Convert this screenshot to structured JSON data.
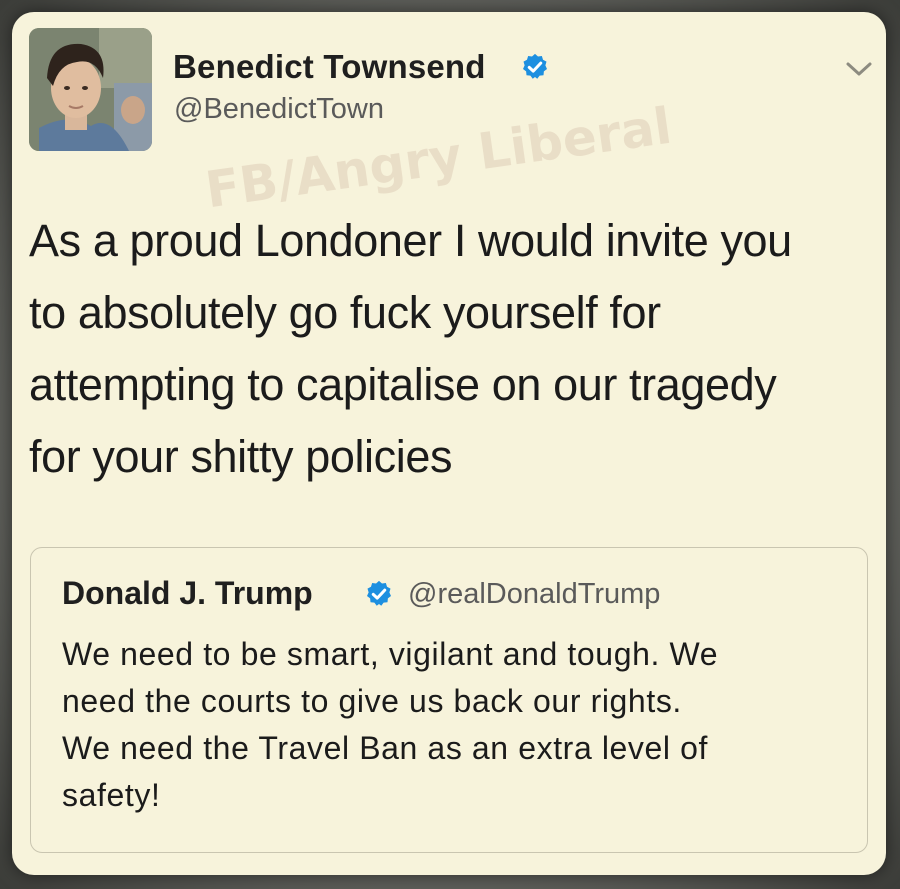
{
  "tweet": {
    "author_name": "Benedict Townsend",
    "author_handle": "@BenedictTown",
    "verified_icon": "verified-badge-icon",
    "menu_icon": "chevron-down-icon",
    "text_lines": [
      "As a proud Londoner I would invite you",
      "to absolutely go fuck yourself for",
      "attempting to capitalise on our tragedy",
      "for your shitty policies"
    ]
  },
  "watermark": "FB/Angry Liberal",
  "quoted_tweet": {
    "author_name": "Donald J. Trump",
    "author_handle": "@realDonaldTrump",
    "verified_icon": "verified-badge-icon",
    "text_lines": [
      "We need to be smart, vigilant and tough. We",
      "need the courts to give us back our rights.",
      "We need the Travel Ban as an extra level of",
      "safety!"
    ]
  },
  "colors": {
    "card_background": "#f7f3db",
    "verified_blue": "#1d8fe0",
    "text_primary": "#1b1b1b",
    "text_secondary": "#5a5a5a"
  }
}
